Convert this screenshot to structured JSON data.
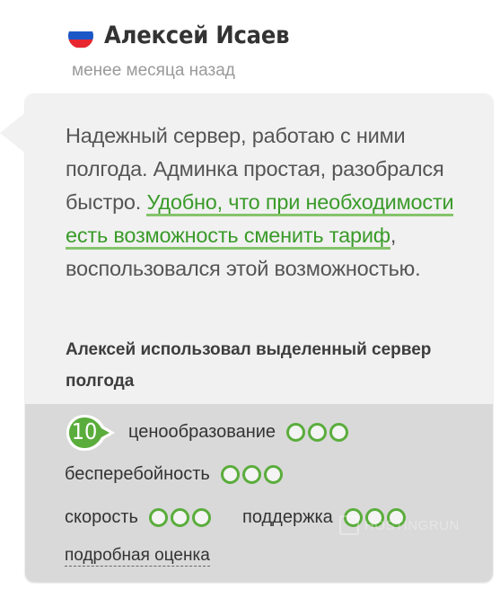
{
  "reviewer": {
    "flag_icon": "russia-flag-icon",
    "name": "Алексей Исаев",
    "date": "менее месяца назад"
  },
  "review": {
    "text_before": "Надежный сервер, работаю с ними полгода. Админка простая, разобрался быстро. ",
    "highlighted": "Удобно, что при необходимости есть возможность сменить тариф",
    "text_after": ", воспользовался этой возможностью.",
    "usage": "Алексей использовал выделенный сервер полгода"
  },
  "ratings": {
    "score": "10",
    "items": [
      {
        "label": "ценообразование",
        "level": 3,
        "max": 3
      },
      {
        "label": "бесперебойность",
        "level": 3,
        "max": 3
      },
      {
        "label": "скорость",
        "level": 3,
        "max": 3
      },
      {
        "label": "поддержка",
        "level": 3,
        "max": 3
      }
    ],
    "detail_link": "подробная оценка"
  },
  "watermark": {
    "text": "HOSTINGRUN"
  },
  "colors": {
    "accent_green": "#5aad3c",
    "highlight_text": "#3a9b2a",
    "card_bg": "#f1f1f1",
    "ratings_bg": "#d9d9d9"
  }
}
